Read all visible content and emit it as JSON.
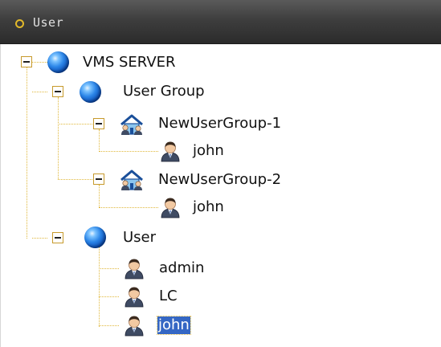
{
  "panel": {
    "title": "User"
  },
  "tree": {
    "root_label": "VMS SERVER",
    "user_group_label": "User Group",
    "groups": [
      {
        "label": "NewUserGroup-1",
        "members": [
          "john"
        ]
      },
      {
        "label": "NewUserGroup-2",
        "members": [
          "john"
        ]
      }
    ],
    "user_node_label": "User",
    "users": [
      "admin",
      "LC",
      "john"
    ],
    "selected_user": "john"
  },
  "colors": {
    "titlebar": "#3e3e3e",
    "title_dot": "#e2b92a",
    "connector_lines": "#e0b83c",
    "selection_bg": "#3567c4"
  },
  "icons": {
    "root": "globe-icon",
    "group_folder": "globe-icon",
    "group": "house-group-icon",
    "user": "user-icon",
    "toggle": "collapse-minus-icon"
  }
}
